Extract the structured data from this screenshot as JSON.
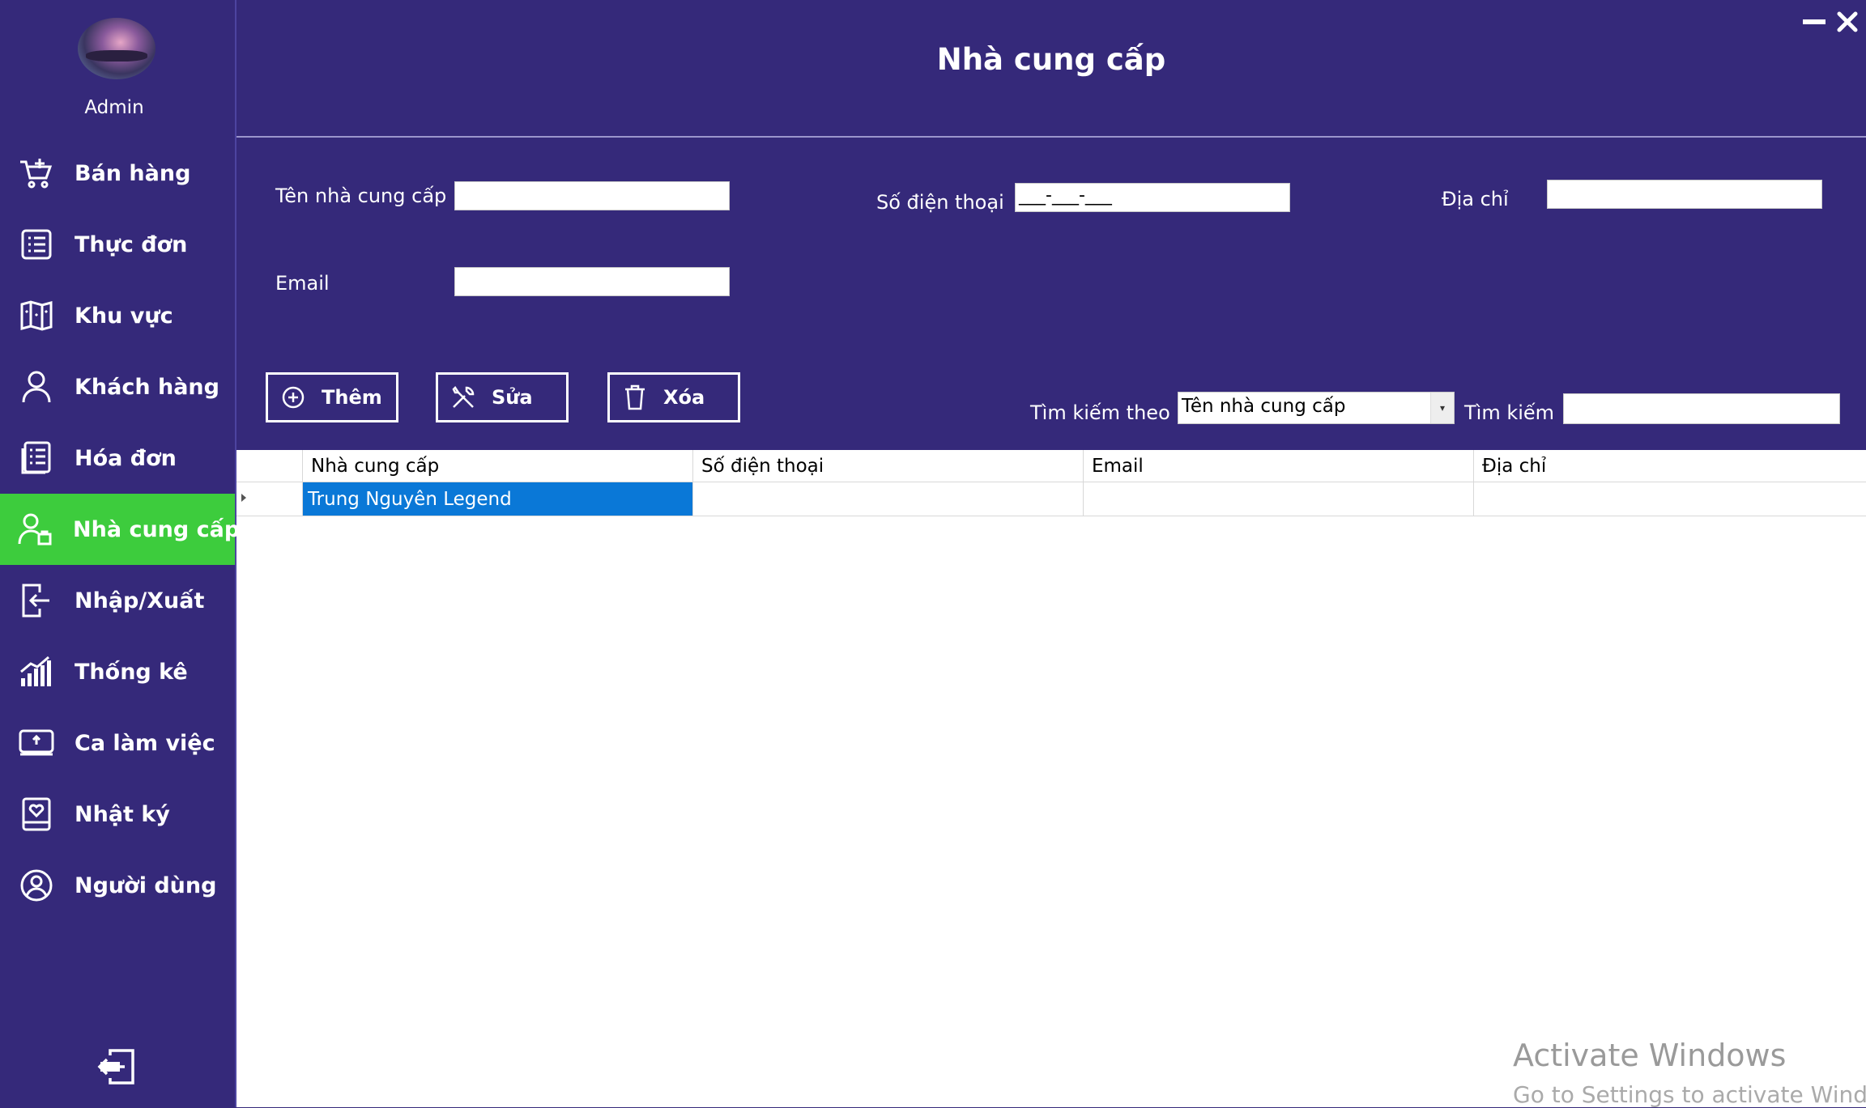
{
  "user": {
    "name": "Admin"
  },
  "sidebar": {
    "items": [
      {
        "label": "Bán hàng",
        "icon": "cart-icon"
      },
      {
        "label": "Thực đơn",
        "icon": "menu-list-icon"
      },
      {
        "label": "Khu vực",
        "icon": "map-icon"
      },
      {
        "label": "Khách hàng",
        "icon": "person-icon"
      },
      {
        "label": "Hóa đơn",
        "icon": "invoice-icon"
      },
      {
        "label": "Nhà cung cấp",
        "icon": "supplier-icon",
        "active": true
      },
      {
        "label": "Nhập/Xuất",
        "icon": "import-export-icon"
      },
      {
        "label": "Thống kê",
        "icon": "bar-chart-icon"
      },
      {
        "label": "Ca làm việc",
        "icon": "laptop-icon"
      },
      {
        "label": "Nhật ký",
        "icon": "journal-icon"
      },
      {
        "label": "Người dùng",
        "icon": "user-circle-icon"
      }
    ],
    "logout_icon": "logout-icon"
  },
  "page": {
    "title": "Nhà cung cấp"
  },
  "form": {
    "name_label": "Tên nhà cung cấp",
    "name_value": "",
    "phone_label": "Số điện thoại",
    "phone_mask": "___-___-___",
    "address_label": "Địa chỉ",
    "address_value": "",
    "email_label": "Email",
    "email_value": ""
  },
  "actions": {
    "add_label": "Thêm",
    "edit_label": "Sửa",
    "delete_label": "Xóa"
  },
  "search": {
    "by_label": "Tìm kiếm theo",
    "by_value": "Tên nhà cung cấp",
    "label": "Tìm kiếm",
    "value": ""
  },
  "grid": {
    "columns": [
      "Nhà cung cấp",
      "Số điện thoại",
      "Email",
      "Địa chỉ"
    ],
    "rows": [
      [
        "Trung Nguyên Legend",
        "",
        "",
        ""
      ]
    ]
  },
  "watermark": {
    "line1": "Activate Windows",
    "line2": "Go to Settings to activate Windows."
  },
  "colors": {
    "background": "#35297a",
    "active_nav": "#3dcc3d",
    "selection": "#0a78d7"
  }
}
